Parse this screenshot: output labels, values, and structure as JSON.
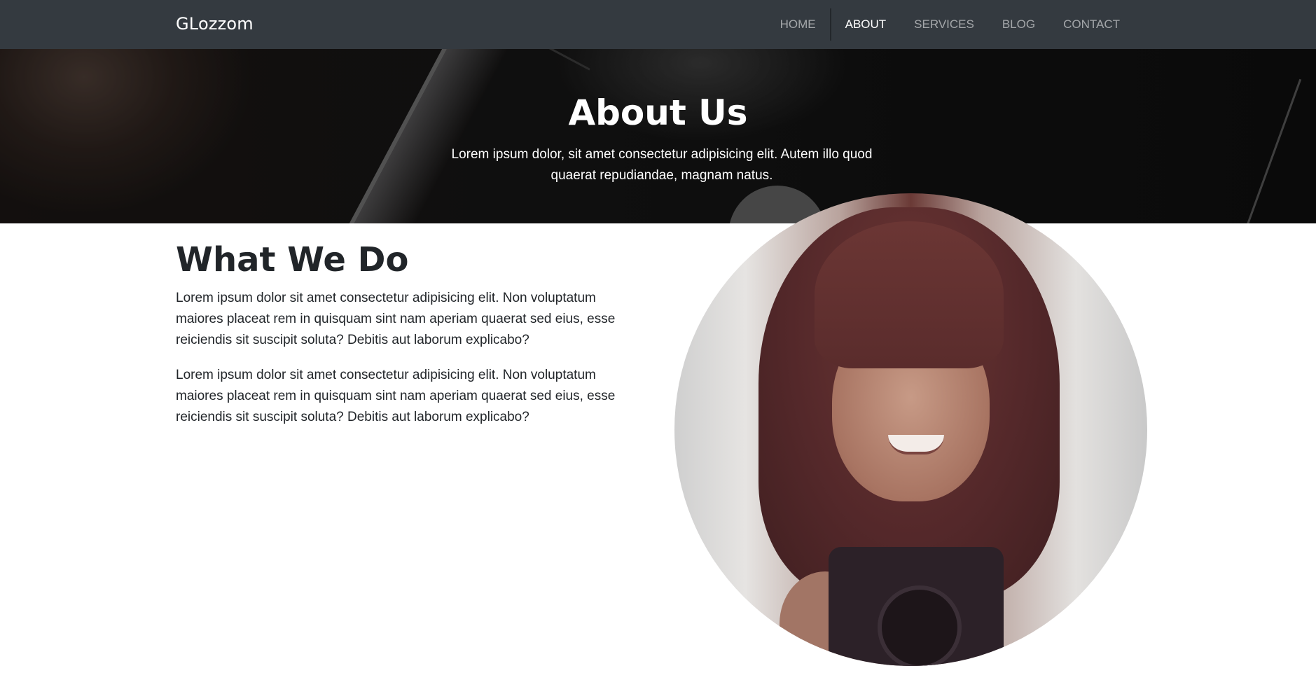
{
  "navbar": {
    "brand": "GLozzom",
    "items": [
      {
        "label": "HOME",
        "active": false
      },
      {
        "label": "ABOUT",
        "active": true
      },
      {
        "label": "SERVICES",
        "active": false
      },
      {
        "label": "BLOG",
        "active": false
      },
      {
        "label": "CONTACT",
        "active": false
      }
    ]
  },
  "hero": {
    "title": "About Us",
    "text": "Lorem ipsum dolor, sit amet consectetur adipisicing elit. Autem illo quod quaerat repudiandae, magnam natus."
  },
  "section": {
    "title": "What We Do",
    "paragraphs": [
      "Lorem ipsum dolor sit amet consectetur adipisicing elit. Non voluptatum maiores placeat rem in quisquam sint nam aperiam quaerat sed eius, esse reiciendis sit suscipit soluta? Debitis aut laborum explicabo?",
      "Lorem ipsum dolor sit amet consectetur adipisicing elit. Non voluptatum maiores placeat rem in quisquam sint nam aperiam quaerat sed eius, esse reiciendis sit suscipit soluta? Debitis aut laborum explicabo?"
    ]
  },
  "colors": {
    "navbar_bg": "#343a40",
    "nav_link": "#9a9da0",
    "nav_link_active": "#ffffff",
    "text": "#212529"
  },
  "icons": {
    "photo": "woman-with-camera-photo"
  }
}
